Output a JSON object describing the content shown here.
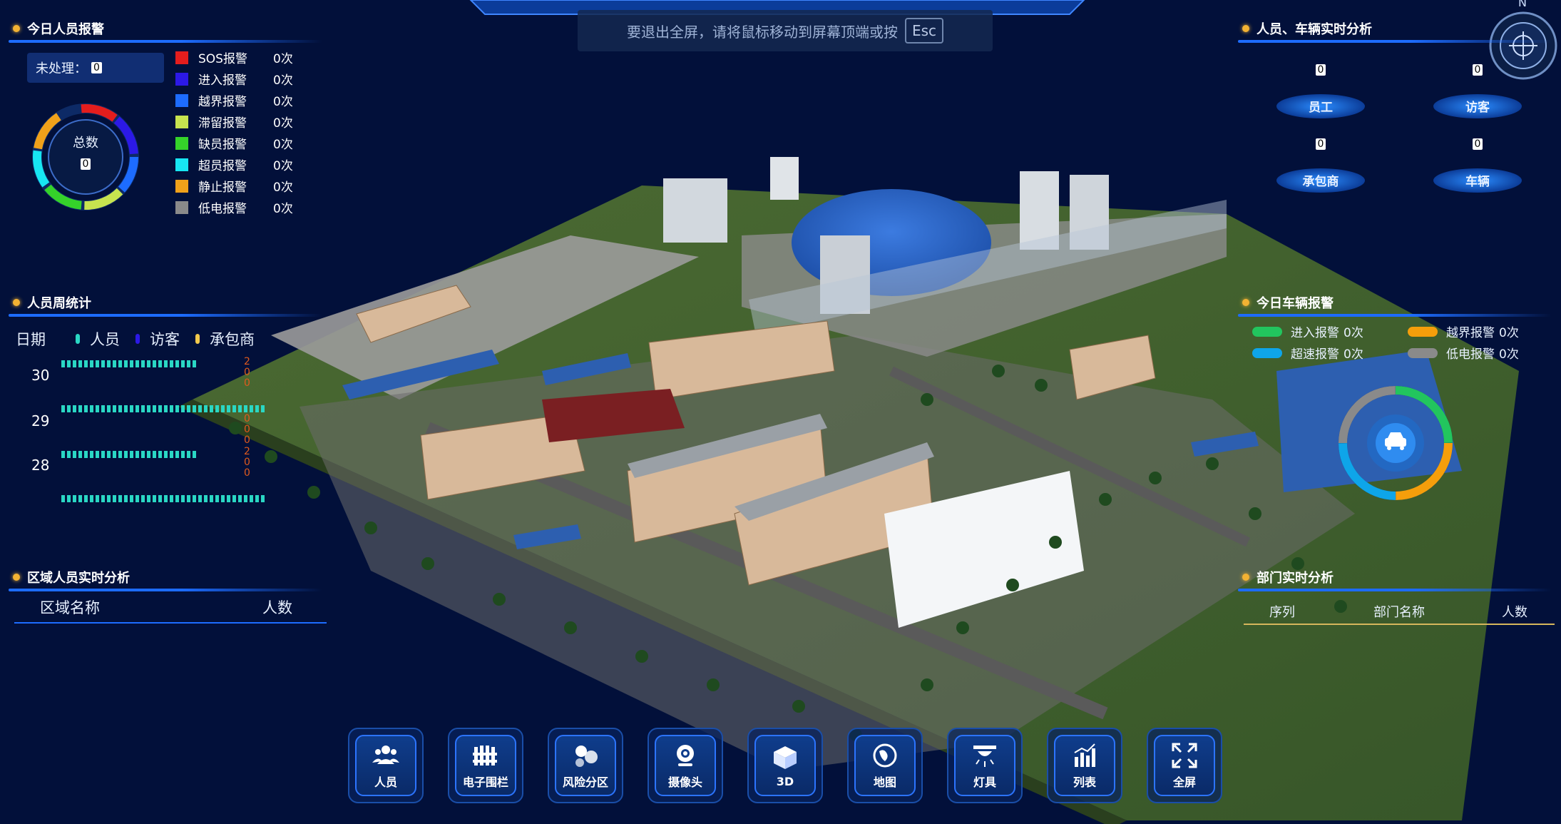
{
  "fullscreen_hint": {
    "text": "要退出全屏，请将鼠标移动到屏幕顶端或按",
    "key": "Esc"
  },
  "compass": {
    "north": "N"
  },
  "alarm_panel": {
    "title": "今日人员报警",
    "unprocessed_label": "未处理：",
    "unprocessed_value": "0",
    "total_label": "总数",
    "total_value": "0",
    "items": [
      {
        "label": "SOS报警",
        "count": "0次",
        "color": "#e41d1d"
      },
      {
        "label": "进入报警",
        "count": "0次",
        "color": "#2c19e6"
      },
      {
        "label": "越界报警",
        "count": "0次",
        "color": "#1d6cff"
      },
      {
        "label": "滞留报警",
        "count": "0次",
        "color": "#c7e34f"
      },
      {
        "label": "缺员报警",
        "count": "0次",
        "color": "#35d22a"
      },
      {
        "label": "超员报警",
        "count": "0次",
        "color": "#17e6f2"
      },
      {
        "label": "静止报警",
        "count": "0次",
        "color": "#f0a11a"
      },
      {
        "label": "低电报警",
        "count": "0次",
        "color": "#8a8a8a"
      }
    ]
  },
  "weekly_panel": {
    "title": "人员周统计",
    "date_label": "日期",
    "legend": [
      {
        "label": "人员",
        "color": "#2ad7c4"
      },
      {
        "label": "访客",
        "color": "#2c19e6"
      },
      {
        "label": "承包商",
        "color": "#f2c94c"
      }
    ],
    "rows": [
      {
        "date": "30",
        "value": "200"
      },
      {
        "date": "29",
        "value": "000"
      },
      {
        "date": "28",
        "value": "200"
      }
    ]
  },
  "area_panel": {
    "title": "区域人员实时分析",
    "col_name": "区域名称",
    "col_count": "人数"
  },
  "people_vehicle_panel": {
    "title": "人员、车辆实时分析",
    "items": [
      {
        "label": "员工",
        "value": "0"
      },
      {
        "label": "访客",
        "value": "0"
      },
      {
        "label": "承包商",
        "value": "0"
      },
      {
        "label": "车辆",
        "value": "0"
      }
    ]
  },
  "vehicle_alarm_panel": {
    "title": "今日车辆报警",
    "items": [
      {
        "label": "进入报警",
        "count": "0次",
        "color": "#22c55e"
      },
      {
        "label": "越界报警",
        "count": "0次",
        "color": "#f59e0b"
      },
      {
        "label": "超速报警",
        "count": "0次",
        "color": "#0ea5e9"
      },
      {
        "label": "低电报警",
        "count": "0次",
        "color": "#8a8a8a"
      }
    ]
  },
  "dept_panel": {
    "title": "部门实时分析",
    "col_index": "序列",
    "col_name": "部门名称",
    "col_count": "人数"
  },
  "toolbar": [
    {
      "label": "人员",
      "icon": "people-icon"
    },
    {
      "label": "电子围栏",
      "icon": "fence-icon"
    },
    {
      "label": "风险分区",
      "icon": "risk-zone-icon"
    },
    {
      "label": "摄像头",
      "icon": "camera-icon"
    },
    {
      "label": "3D",
      "icon": "cube-icon"
    },
    {
      "label": "地图",
      "icon": "globe-icon"
    },
    {
      "label": "灯具",
      "icon": "lamp-icon"
    },
    {
      "label": "列表",
      "icon": "chart-icon"
    },
    {
      "label": "全屏",
      "icon": "fullscreen-icon"
    }
  ]
}
